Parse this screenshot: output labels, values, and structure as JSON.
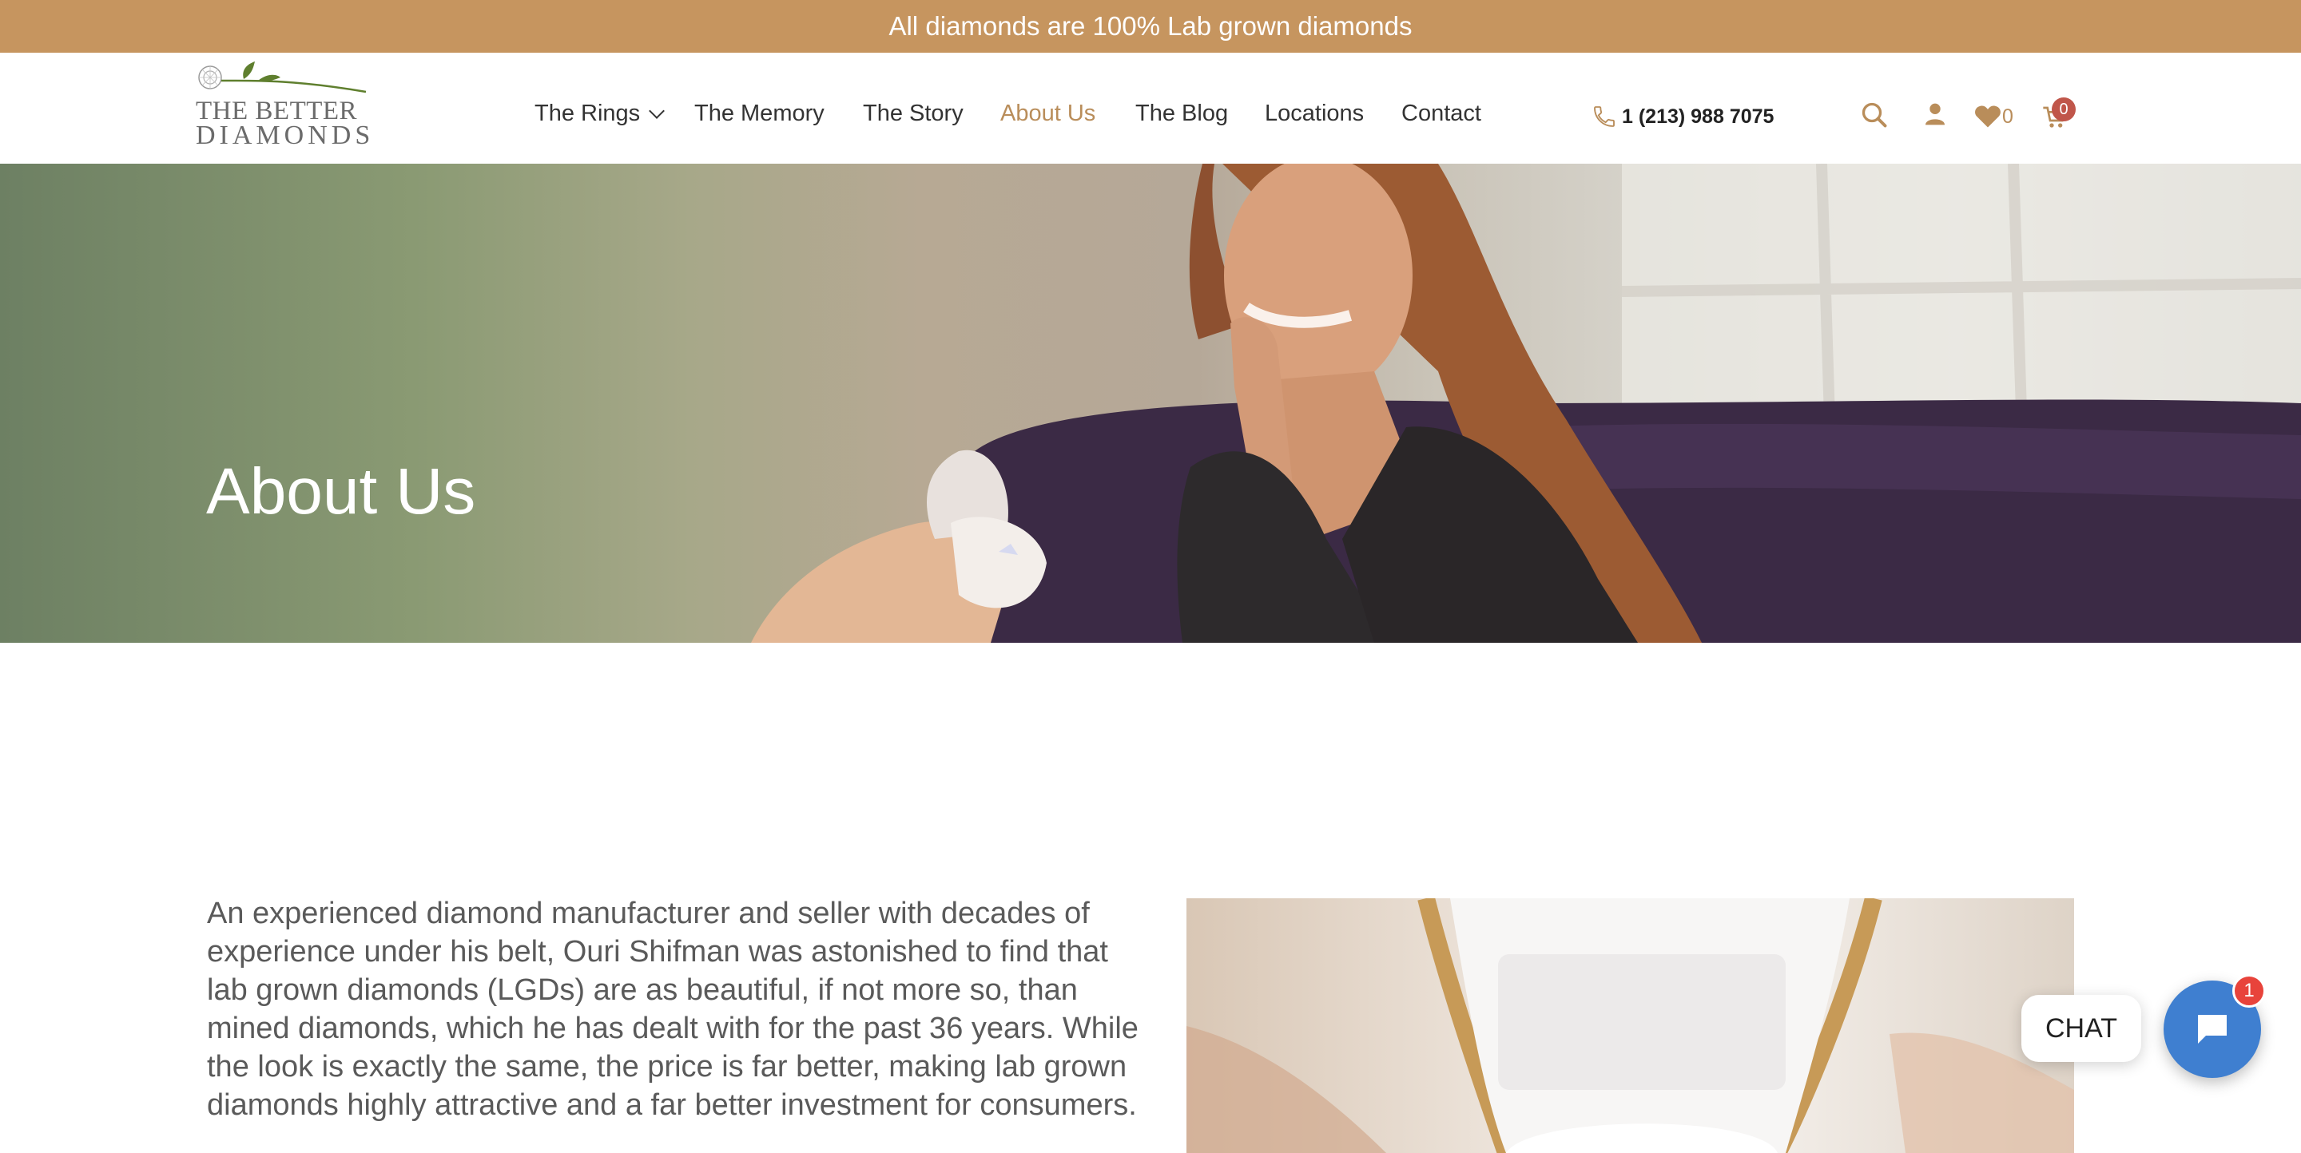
{
  "announcement": {
    "text": "All diamonds are 100% Lab grown diamonds"
  },
  "header": {
    "logo": {
      "line1": "THE BETTER",
      "line2": "DIAMONDS"
    },
    "nav": [
      {
        "label": "The Rings",
        "has_dropdown": true,
        "active": false
      },
      {
        "label": "The Memory",
        "active": false
      },
      {
        "label": "The Story",
        "active": false
      },
      {
        "label": "About Us",
        "active": true
      },
      {
        "label": "The Blog",
        "active": false
      },
      {
        "label": "Locations",
        "active": false
      },
      {
        "label": "Contact",
        "active": false
      }
    ],
    "phone": "1 (213) 988 7075",
    "icons": [
      "phone-icon",
      "search-icon",
      "user-icon",
      "heart-icon",
      "cart-icon"
    ],
    "wishlist_count": "0",
    "cart_count": "0"
  },
  "hero": {
    "title": "About Us"
  },
  "content": {
    "paragraph": "An experienced diamond manufacturer and seller with decades of experience under his belt, Ouri Shifman was astonished to find that lab grown diamonds (LGDs) are as beautiful, if not more so, than mined diamonds, which he has dealt with for the past 36 years. While the look is exactly the same, the price is far better, making lab grown diamonds highly attractive and a far better investment for consumers."
  },
  "chat": {
    "label": "CHAT",
    "badge": "1"
  },
  "colors": {
    "announcement_bg": "#c6955f",
    "accent": "#b98d5a",
    "logo_green": "#5f7f2e",
    "chat_blue": "#3f7fd0",
    "badge_red": "#e8433b"
  }
}
